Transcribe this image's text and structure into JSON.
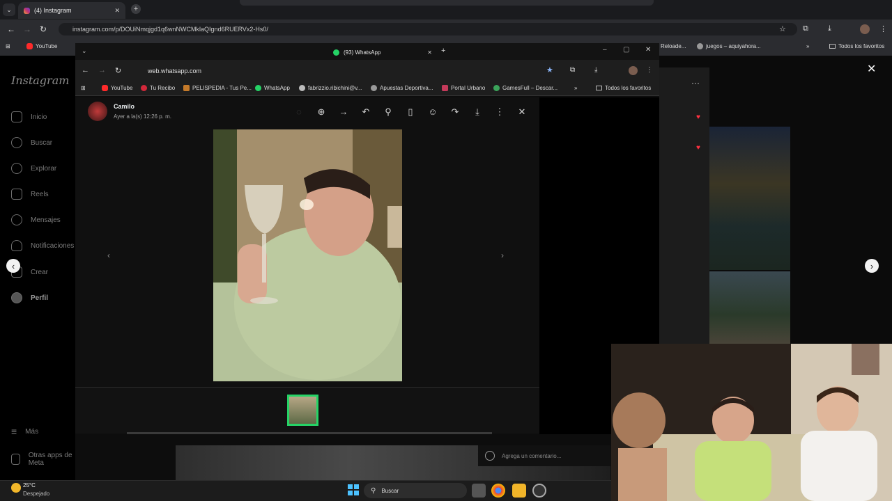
{
  "outer_browser": {
    "tab_title": "(4) Instagram",
    "url": "instagram.com/p/DOUiNmqjgd1q6wnNWCMklaQIgnd6RUERVx2-Hs0/",
    "bookmarks": [
      "YouTube",
      "Reloade...",
      "juegos – aquiyahora...",
      "Todos los favoritos"
    ]
  },
  "instagram": {
    "logo": "Instagram",
    "nav": [
      "Inicio",
      "Buscar",
      "Explorar",
      "Reels",
      "Mensajes",
      "Notificaciones",
      "Crear",
      "Perfil"
    ],
    "more": "Más",
    "other_apps": "Otras apps de Meta",
    "comment_placeholder": "Agrega un comentario..."
  },
  "inner_browser": {
    "tab_title": "(93) WhatsApp",
    "url": "web.whatsapp.com",
    "bookmarks": [
      "YouTube",
      "Tu Recibo",
      "PELISPEDIA - Tus Pe...",
      "WhatsApp",
      "fabrizzio.ribichini@v...",
      "Apuestas Deportiva...",
      "Portal Urbano",
      "GamesFull – Descar..."
    ],
    "all_bookmarks": "Todos los favoritos"
  },
  "whatsapp_viewer": {
    "contact_name": "Camilo",
    "timestamp": "Ayer a la(s) 12:26 p. m.",
    "actions": [
      "zoom-in-icon",
      "forward-icon",
      "reply-icon",
      "pin-icon",
      "bookmark-icon",
      "emoji-icon",
      "share-icon",
      "download-icon",
      "more-icon",
      "close-icon"
    ]
  },
  "taskbar": {
    "weather_temp": "25°C",
    "weather_desc": "Despejado",
    "search_label": "Buscar"
  }
}
